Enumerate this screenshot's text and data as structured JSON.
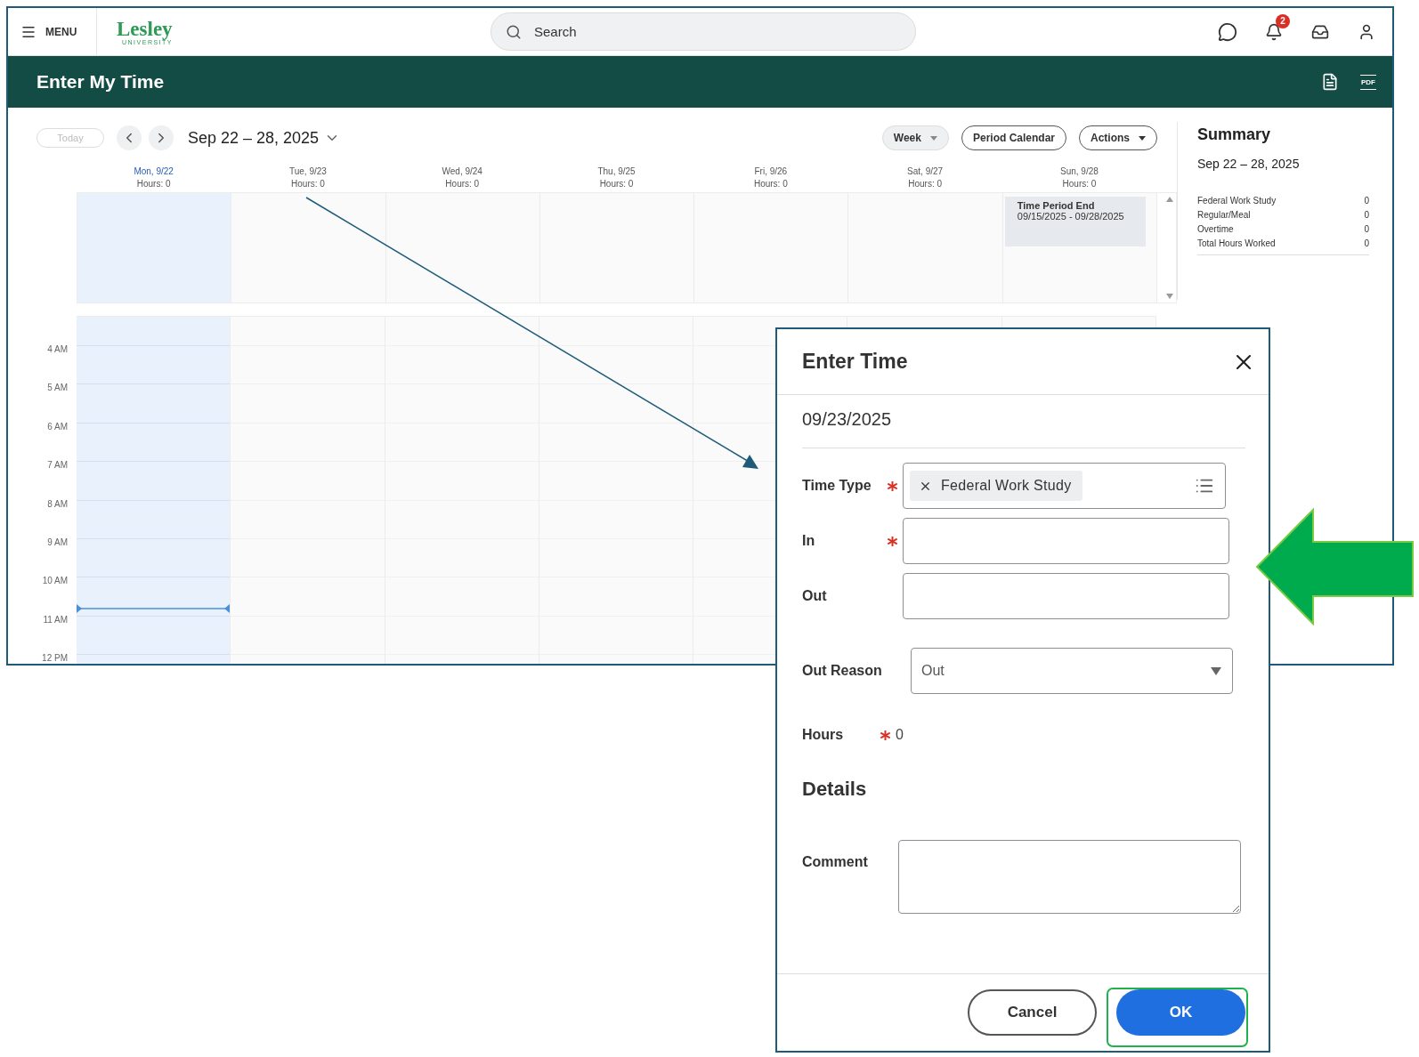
{
  "top_bar": {
    "menu_label": "MENU",
    "logo": {
      "name": "Lesley",
      "tagline": "UNIVERSITY"
    },
    "search": {
      "placeholder": "Search"
    },
    "notification_count": "2"
  },
  "page_header": {
    "title": "Enter My Time",
    "pdf_label": "PDF"
  },
  "toolbar": {
    "today": {
      "label": "Today",
      "disabled": true
    },
    "date_range": "Sep 22 – 28, 2025",
    "view": "Week",
    "buttons": [
      {
        "label": "Period Calendar",
        "kind": "plain"
      },
      {
        "label": "Actions",
        "kind": "menu"
      }
    ]
  },
  "days": [
    {
      "label": "Mon, 9/22",
      "hours": "Hours: 0",
      "selected": true
    },
    {
      "label": "Tue, 9/23",
      "hours": "Hours: 0",
      "selected": false
    },
    {
      "label": "Wed, 9/24",
      "hours": "Hours: 0",
      "selected": false
    },
    {
      "label": "Thu, 9/25",
      "hours": "Hours: 0",
      "selected": false
    },
    {
      "label": "Fri, 9/26",
      "hours": "Hours: 0",
      "selected": false
    },
    {
      "label": "Sat, 9/27",
      "hours": "Hours: 0",
      "selected": false
    },
    {
      "label": "Sun, 9/28",
      "hours": "Hours: 0",
      "selected": false,
      "events": [
        {
          "title": "Time Period End",
          "dates": "09/15/2025 - 09/28/2025"
        }
      ]
    }
  ],
  "hour_labels": [
    "4 AM",
    "5 AM",
    "6 AM",
    "7 AM",
    "8 AM",
    "9 AM",
    "10 AM",
    "11 AM",
    "12 PM"
  ],
  "summary": {
    "title": "Summary",
    "range": "Sep 22 – 28, 2025",
    "rows": [
      {
        "label": "Federal Work Study",
        "value": "0"
      },
      {
        "label": "Regular/Meal",
        "value": "0"
      },
      {
        "label": "Overtime",
        "value": "0"
      },
      {
        "label": "Total Hours Worked",
        "value": "0"
      }
    ]
  },
  "dialog": {
    "title": "Enter Time",
    "date": "09/23/2025",
    "fields": [
      {
        "label": "Time Type",
        "required": true,
        "kind": "chip",
        "value": "Federal Work Study"
      },
      {
        "label": "In",
        "required": true,
        "kind": "text"
      },
      {
        "label": "Out",
        "required": false,
        "kind": "text"
      },
      {
        "label": "Out Reason",
        "required": false,
        "kind": "select",
        "value": "Out"
      },
      {
        "label": "Hours",
        "required": true,
        "kind": "readonly",
        "value": "0"
      }
    ],
    "section": "Details",
    "comment": {
      "label": "Comment"
    },
    "buttons": [
      {
        "label": "Cancel",
        "kind": "secondary"
      },
      {
        "label": "OK",
        "kind": "primary"
      }
    ]
  }
}
